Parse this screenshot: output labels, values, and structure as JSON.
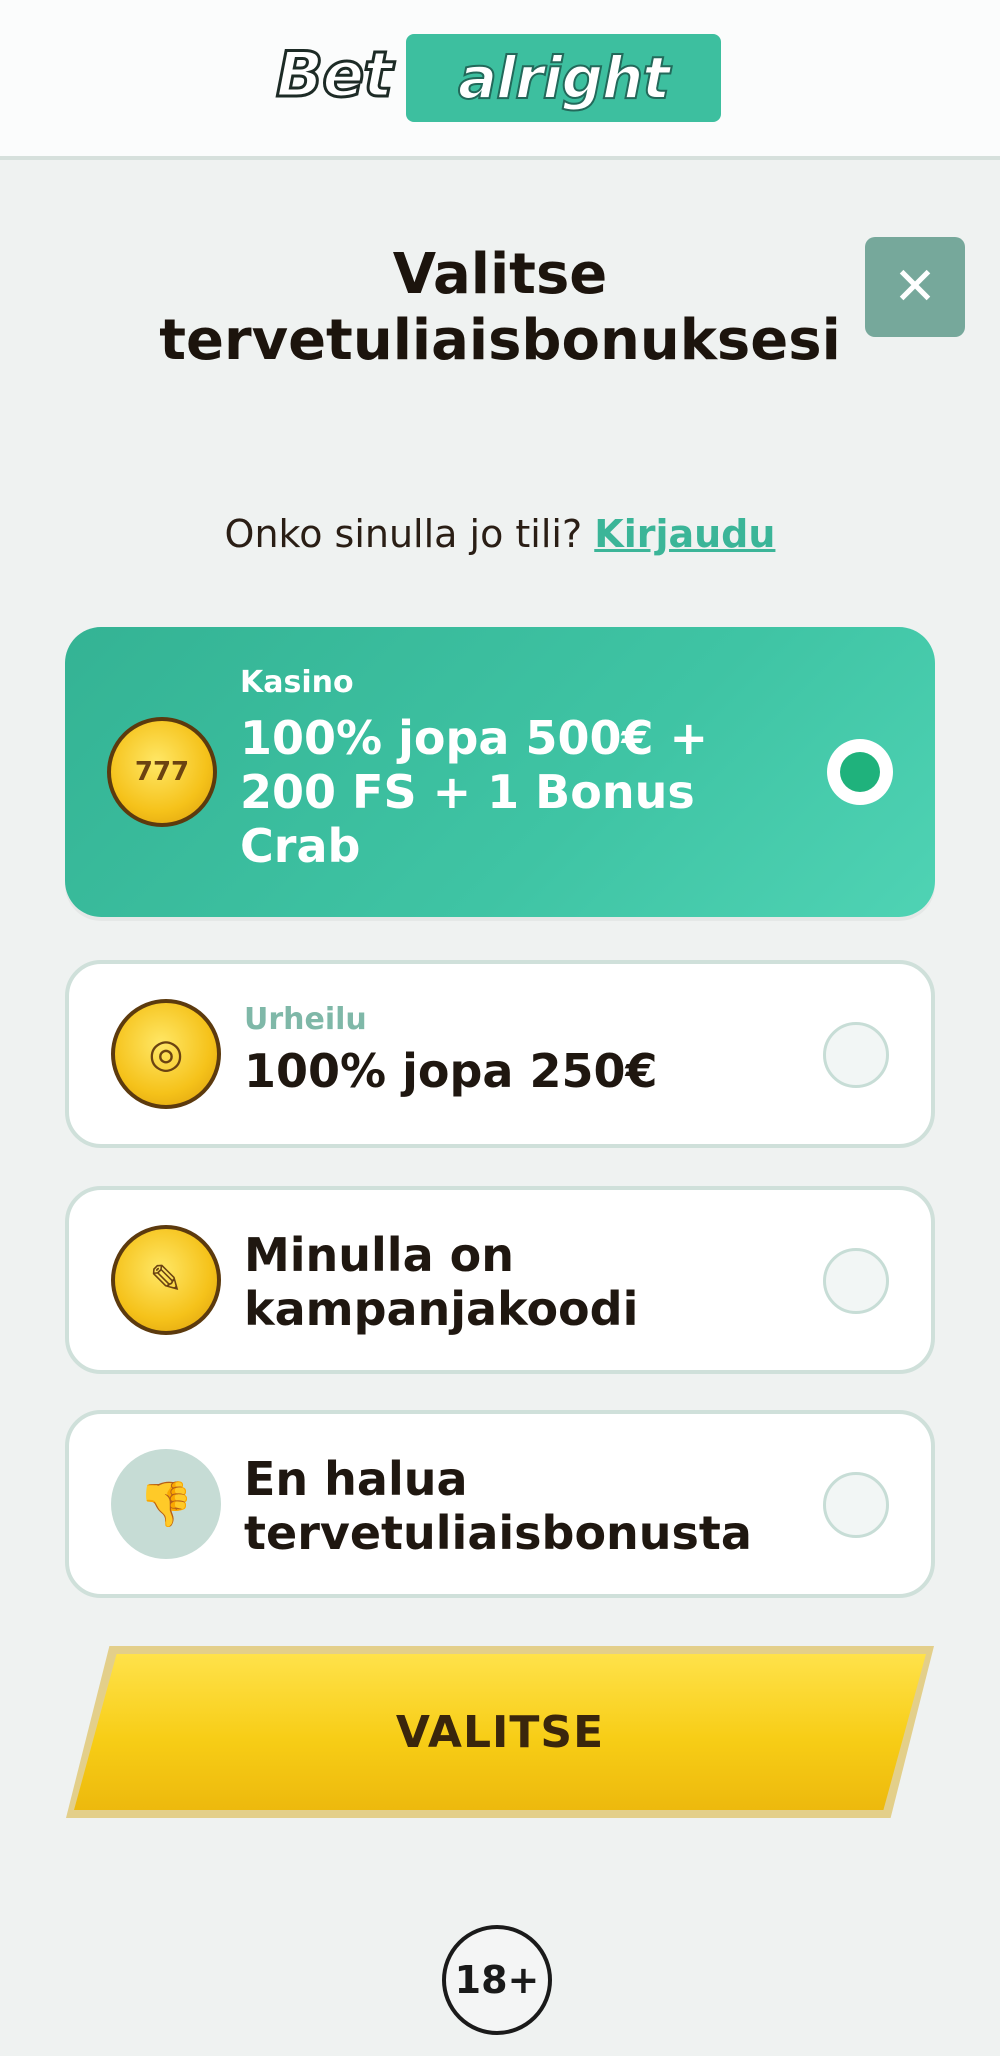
{
  "logo": {
    "part1": "Bet",
    "part2": "alright"
  },
  "close_icon_glyph": "✕",
  "title": "Valitse tervetuliaisbonuksesi",
  "login": {
    "prompt": "Onko sinulla jo tili?",
    "link": "Kirjaudu"
  },
  "options": [
    {
      "category": "Kasino",
      "title": "100% jopa 500€ + 200 FS + 1 Bonus Crab",
      "icon": "slot-machine-icon",
      "icon_text": "777",
      "selected": true
    },
    {
      "category": "Urheilu",
      "title": "100% jopa 250€",
      "icon": "sports-ball-icon",
      "icon_text": "◎",
      "selected": false
    },
    {
      "category": "",
      "title": "Minulla on kampanjakoodi",
      "icon": "ticket-icon",
      "icon_text": "✎",
      "selected": false
    },
    {
      "category": "",
      "title": "En halua tervetuliaisbonusta",
      "icon": "thumbs-down-icon",
      "icon_text": "👎",
      "selected": false
    }
  ],
  "submit_label": "VALITSE",
  "age_badge": "18+",
  "colors": {
    "accent": "#3dbf9f",
    "button": "#f7cd16",
    "background": "#eff2f1"
  }
}
